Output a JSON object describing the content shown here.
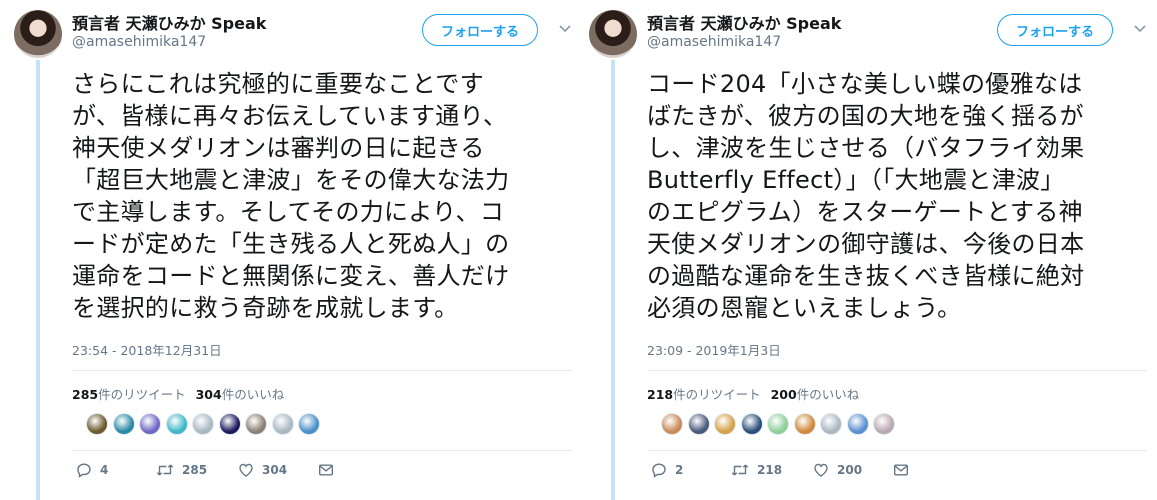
{
  "tweets": [
    {
      "author": {
        "name": "預言者 天瀬ひみか Speak",
        "handle": "@amasehimika147"
      },
      "follow_label": "フォローする",
      "text": "さらにこれは究極的に重要なことです\nが、皆様に再々お伝えしています通り、\n神天使メダリオンは審判の日に起きる\n「超巨大地震と津波」をその偉大な法力\nで主導します。そしてその力により、コ\nードが定めた「生き残る人と死ぬ人」の\n運命をコードと無関係に変え、善人だけ\nを選択的に救う奇跡を成就します。",
      "timestamp": "23:54 - 2018年12月31日",
      "retweets": {
        "count": "285",
        "label": "件のリツイート"
      },
      "likes": {
        "count": "304",
        "label": "件のいいね"
      },
      "liker_colors": [
        "#6b5a2c",
        "#2b8aa6",
        "#6e67c4",
        "#3fb7c9",
        "#aab8c2",
        "#1a1a5e",
        "#8c7f73",
        "#aab8c2",
        "#4a90c8"
      ],
      "actions": {
        "reply": "4",
        "retweet": "285",
        "like": "304"
      }
    },
    {
      "author": {
        "name": "預言者 天瀬ひみか Speak",
        "handle": "@amasehimika147"
      },
      "follow_label": "フォローする",
      "text": "コード204「小さな美しい蝶の優雅なは\nばたきが、彼方の国の大地を強く揺るが\nし、津波を生じさせる（バタフライ効果\nButterfly Effect）」（「大地震と津波」\nのエピグラム）をスターゲートとする神\n天使メダリオンの御守護は、今後の日本\nの過酷な運命を生き抜くべき皆様に絶対\n必須の恩寵といえましょう。",
      "timestamp": "23:09 - 2019年1月3日",
      "retweets": {
        "count": "218",
        "label": "件のリツイート"
      },
      "likes": {
        "count": "200",
        "label": "件のいいね"
      },
      "liker_colors": [
        "#c98a5a",
        "#4b5a7a",
        "#d6a24a",
        "#2c4f7a",
        "#8fcf9a",
        "#d08a3c",
        "#aab8c2",
        "#5a8fd0",
        "#b9a8b0"
      ],
      "actions": {
        "reply": "2",
        "retweet": "218",
        "like": "200"
      }
    }
  ],
  "colors": {
    "accent": "#1da1f2",
    "thread_line": "#c4e2f7",
    "muted": "#657786"
  }
}
